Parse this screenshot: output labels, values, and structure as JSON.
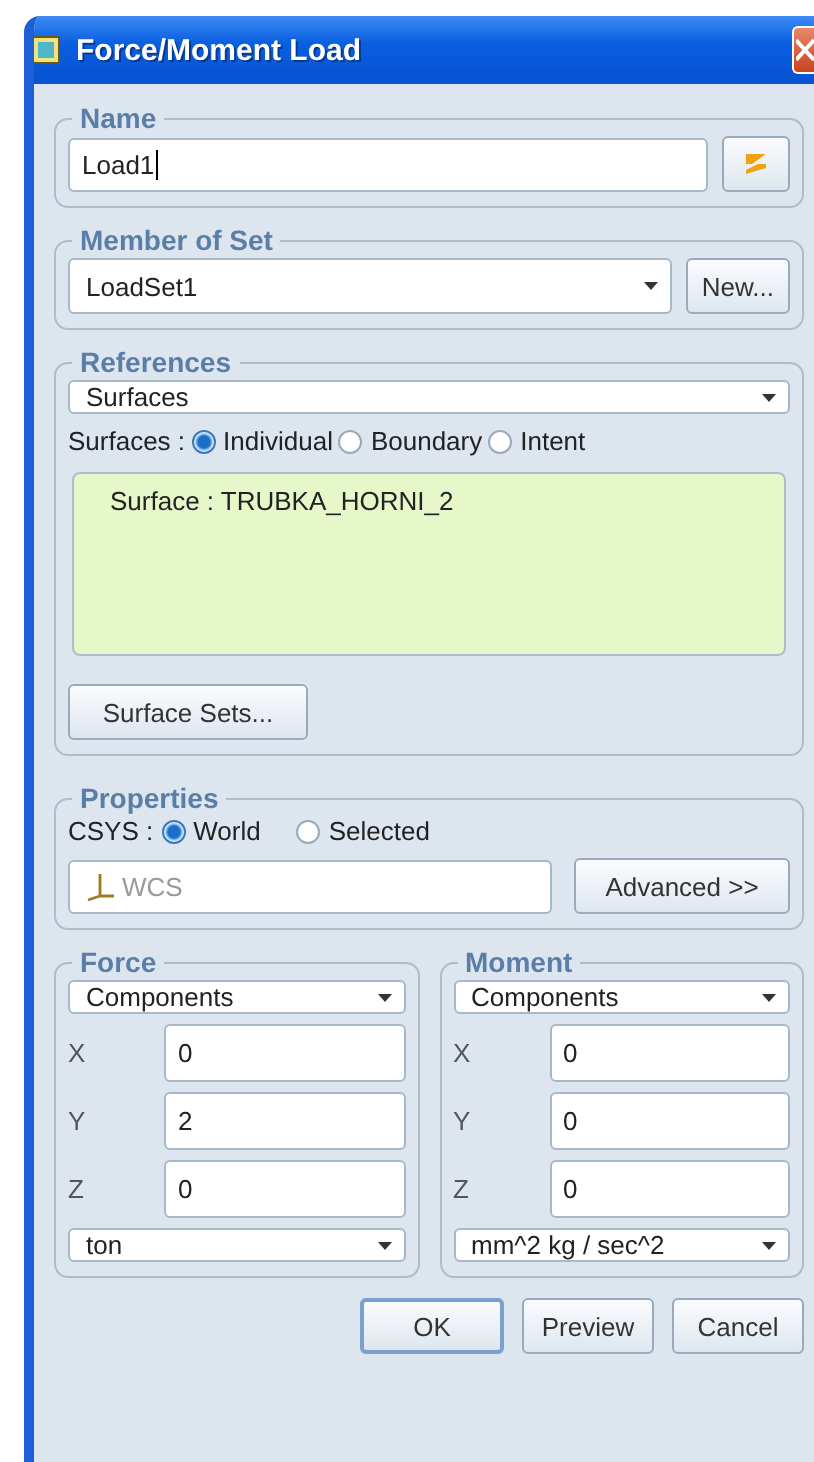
{
  "window": {
    "title": "Force/Moment Load"
  },
  "name": {
    "legend": "Name",
    "value": "Load1"
  },
  "member_of_set": {
    "legend": "Member of Set",
    "value": "LoadSet1",
    "new_button": "New..."
  },
  "references": {
    "legend": "References",
    "type": "Surfaces",
    "mode_label": "Surfaces :",
    "modes": [
      {
        "label": "Individual",
        "selected": true
      },
      {
        "label": "Boundary",
        "selected": false
      },
      {
        "label": "Intent",
        "selected": false
      }
    ],
    "items": [
      "Surface : TRUBKA_HORNI_2"
    ],
    "sets_button": "Surface Sets..."
  },
  "properties": {
    "legend": "Properties",
    "csys_label": "CSYS :",
    "csys": [
      {
        "label": "World",
        "selected": true
      },
      {
        "label": "Selected",
        "selected": false
      }
    ],
    "csys_field": {
      "value": "WCS",
      "disabled": true
    },
    "advanced_button": "Advanced >>"
  },
  "force": {
    "legend": "Force",
    "type": "Components",
    "components": [
      {
        "axis": "X",
        "value": "0"
      },
      {
        "axis": "Y",
        "value": "2"
      },
      {
        "axis": "Z",
        "value": "0"
      }
    ],
    "unit": "ton"
  },
  "moment": {
    "legend": "Moment",
    "type": "Components",
    "components": [
      {
        "axis": "X",
        "value": "0"
      },
      {
        "axis": "Y",
        "value": "0"
      },
      {
        "axis": "Z",
        "value": "0"
      }
    ],
    "unit": "mm^2 kg / sec^2"
  },
  "buttons": [
    {
      "label": "OK",
      "default": true
    },
    {
      "label": "Preview",
      "default": false
    },
    {
      "label": "Cancel",
      "default": false
    }
  ]
}
